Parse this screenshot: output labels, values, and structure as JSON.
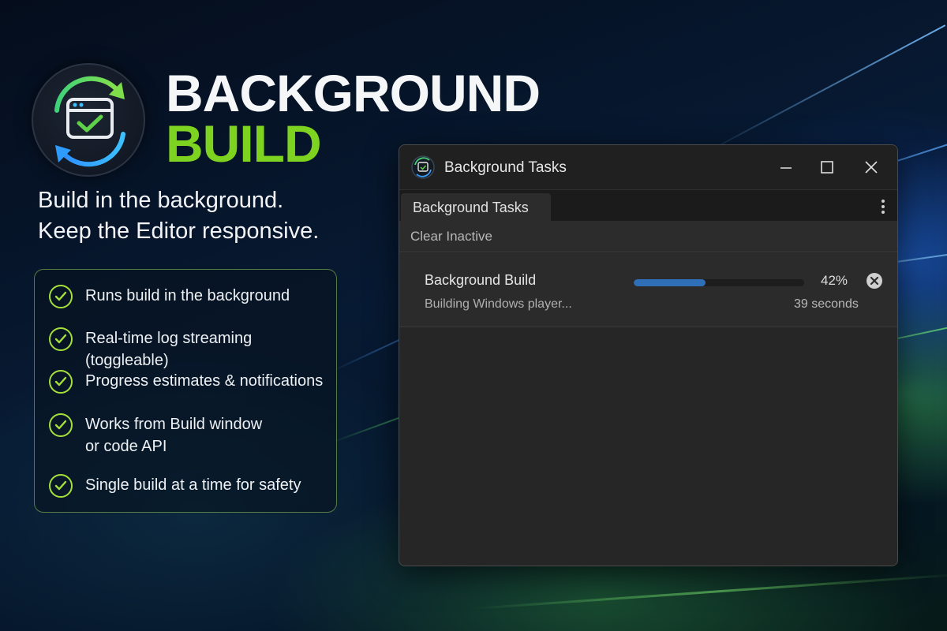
{
  "branding": {
    "title_line1": "BACKGROUND",
    "title_line2": "BUILD",
    "logo_icon": "window-check-sync-icon",
    "accent_color": "#7ed321"
  },
  "tagline": {
    "line1": "Build in the background.",
    "line2": "Keep the Editor responsive."
  },
  "features": [
    {
      "icon": "check-circle-icon",
      "lines": [
        "Runs build in the background"
      ]
    },
    {
      "icon": "check-circle-icon",
      "lines": [
        "Real-time log streaming (toggleable)"
      ]
    },
    {
      "icon": "check-circle-icon",
      "lines": [
        "Progress estimates & notifications"
      ]
    },
    {
      "icon": "check-circle-icon",
      "lines": [
        "Works from Build window",
        "or code API"
      ]
    },
    {
      "icon": "check-circle-icon",
      "lines": [
        "Single build at a time for safety"
      ]
    }
  ],
  "window": {
    "title": "Background Tasks",
    "tab_label": "Background Tasks",
    "toolbar": {
      "clear_label": "Clear Inactive"
    },
    "task": {
      "name": "Background Build",
      "description": "Building Windows player...",
      "progress_percent": 42,
      "progress_label": "42%",
      "time_label": "39 seconds",
      "progress_color": "#2f6fb8"
    }
  }
}
